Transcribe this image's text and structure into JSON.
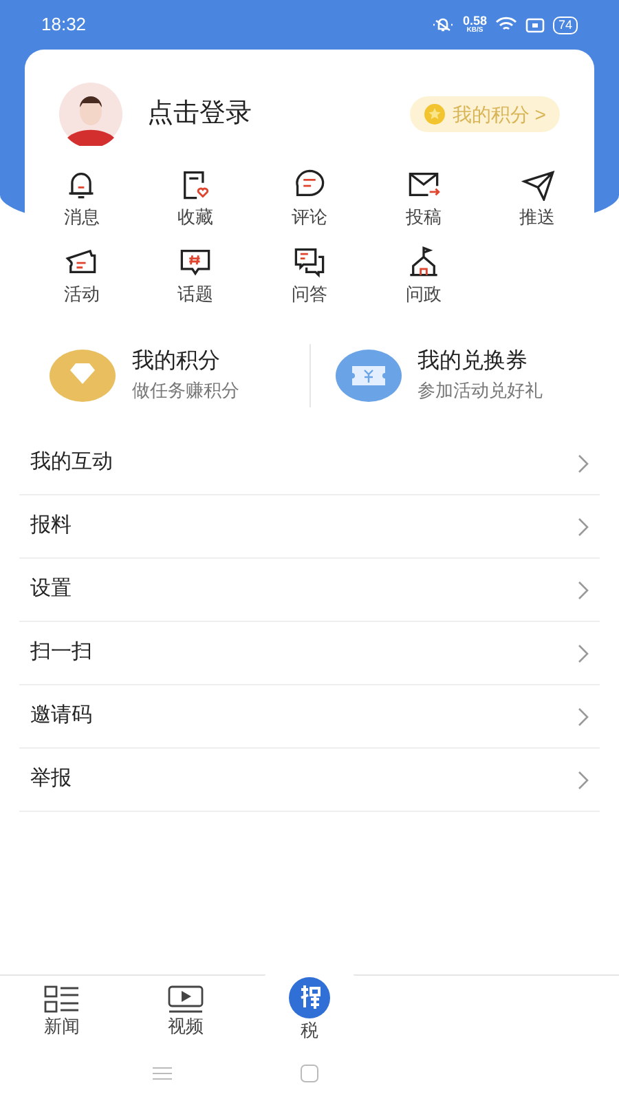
{
  "status_bar": {
    "time": "18:32",
    "speed": "0.58",
    "speed_unit": "KB/S",
    "battery": "74"
  },
  "profile": {
    "login": "点击登录",
    "points_button": "我的积分 >"
  },
  "shortcuts": [
    {
      "label": "消息",
      "kind": "bell"
    },
    {
      "label": "收藏",
      "kind": "favorite"
    },
    {
      "label": "评论",
      "kind": "comment"
    },
    {
      "label": "投稿",
      "kind": "mail"
    },
    {
      "label": "推送",
      "kind": "send"
    },
    {
      "label": "活动",
      "kind": "ticket"
    },
    {
      "label": "话题",
      "kind": "topic"
    },
    {
      "label": "问答",
      "kind": "qa"
    },
    {
      "label": "问政",
      "kind": "gov"
    }
  ],
  "cards": [
    {
      "title": "我的积分",
      "subtitle": "做任务赚积分",
      "kind": "points"
    },
    {
      "title": "我的兑换券",
      "subtitle": "参加活动兑好礼",
      "kind": "coupon"
    }
  ],
  "menu": [
    "我的互动",
    "报料",
    "设置",
    "扫一扫",
    "邀请码",
    "举报"
  ],
  "tabs": [
    {
      "label": "新闻",
      "kind": "news"
    },
    {
      "label": "视频",
      "kind": "video"
    },
    {
      "label": "税",
      "kind": "center"
    }
  ]
}
